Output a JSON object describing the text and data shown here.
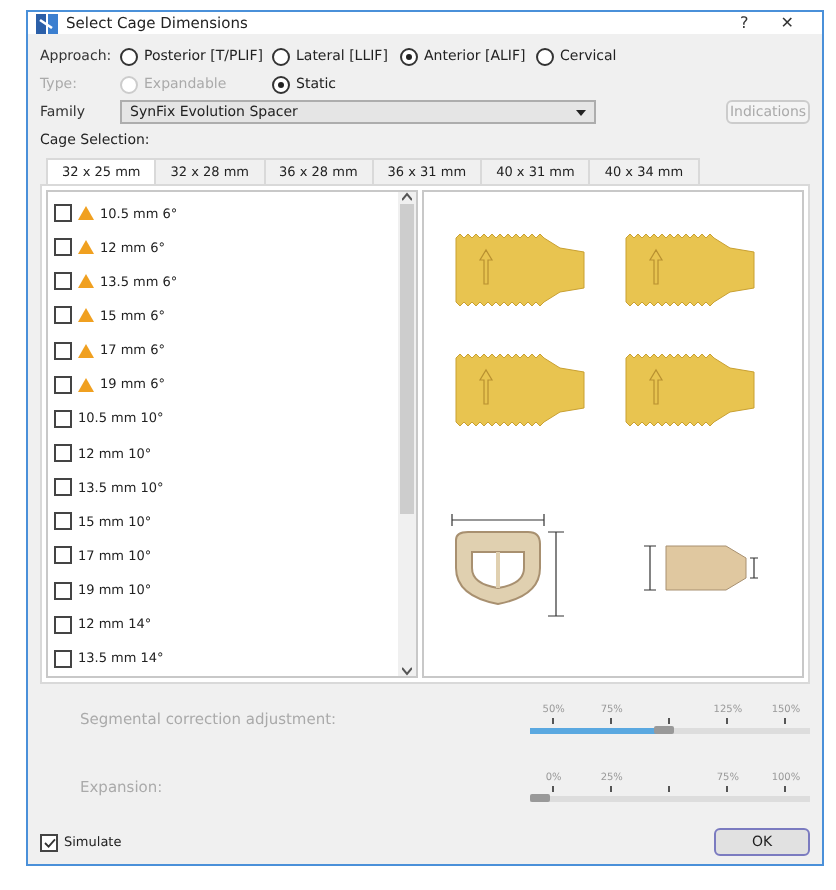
{
  "window": {
    "title": "Select Cage Dimensions",
    "help": "?",
    "close": "✕"
  },
  "approach": {
    "label": "Approach:",
    "options": [
      {
        "label": "Posterior [T/PLIF]",
        "selected": false
      },
      {
        "label": "Lateral [LLIF]",
        "selected": false
      },
      {
        "label": "Anterior [ALIF]",
        "selected": true
      },
      {
        "label": "Cervical",
        "selected": false
      }
    ]
  },
  "type": {
    "label": "Type:",
    "options": [
      {
        "label": "Expandable",
        "selected": false,
        "disabled": true
      },
      {
        "label": "Static",
        "selected": true,
        "disabled": false
      }
    ]
  },
  "family": {
    "label": "Family",
    "value": "SynFix Evolution Spacer"
  },
  "indications_button": {
    "label": "Indications",
    "disabled": true
  },
  "cage_selection": {
    "label": "Cage Selection:",
    "tabs": [
      {
        "label": "32 x 25 mm",
        "selected": true
      },
      {
        "label": "32 x 28 mm",
        "selected": false
      },
      {
        "label": "36 x 28 mm",
        "selected": false
      },
      {
        "label": "36 x 31 mm",
        "selected": false
      },
      {
        "label": "40 x 31 mm",
        "selected": false
      },
      {
        "label": "40 x 34 mm",
        "selected": false
      }
    ],
    "items": [
      {
        "label": "10.5 mm 6°",
        "checked": false,
        "warning": true
      },
      {
        "label": "12 mm 6°",
        "checked": false,
        "warning": true
      },
      {
        "label": "13.5 mm 6°",
        "checked": false,
        "warning": true
      },
      {
        "label": "15 mm 6°",
        "checked": false,
        "warning": true
      },
      {
        "label": "17 mm 6°",
        "checked": false,
        "warning": true
      },
      {
        "label": "19 mm 6°",
        "checked": false,
        "warning": true
      },
      {
        "label": "10.5 mm 10°",
        "checked": false,
        "warning": false
      },
      {
        "label": "12 mm 10°",
        "checked": false,
        "warning": false
      },
      {
        "label": "13.5 mm 10°",
        "checked": false,
        "warning": false
      },
      {
        "label": "15 mm 10°",
        "checked": false,
        "warning": false
      },
      {
        "label": "17 mm 10°",
        "checked": false,
        "warning": false
      },
      {
        "label": "19 mm 10°",
        "checked": false,
        "warning": false
      },
      {
        "label": "12 mm 14°",
        "checked": false,
        "warning": false
      },
      {
        "label": "13.5 mm 14°",
        "checked": false,
        "warning": false
      }
    ]
  },
  "sliders": [
    {
      "label": "Segmental correction adjustment:",
      "level": 0.48,
      "ticks": [
        {
          "kind": "labeled",
          "label": "50%"
        },
        {
          "kind": "labeled",
          "label": "75%"
        },
        {
          "kind": "plain"
        },
        {
          "kind": "labeled",
          "label": "125%"
        },
        {
          "kind": "labeled",
          "label": "150%"
        }
      ]
    },
    {
      "label": "Expansion:",
      "level": 0,
      "ticks": [
        {
          "kind": "labeled",
          "label": "0%"
        },
        {
          "kind": "labeled",
          "label": "25%"
        },
        {
          "kind": "plain"
        },
        {
          "kind": "labeled",
          "label": "75%"
        },
        {
          "kind": "labeled",
          "label": "100%"
        }
      ]
    }
  ],
  "simulate": {
    "label": "Simulate",
    "checked": true
  },
  "ok_button": {
    "label": "OK"
  }
}
